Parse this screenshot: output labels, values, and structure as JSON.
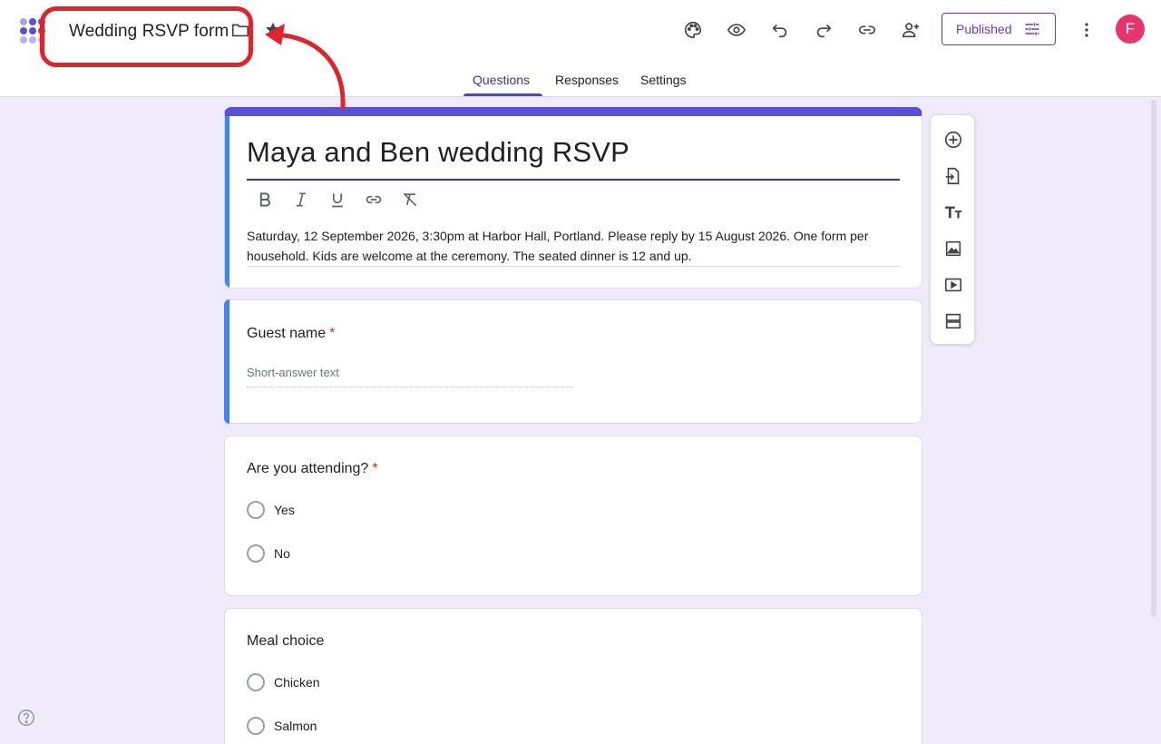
{
  "app": {
    "title": "Wedding RSVP form",
    "accent_color": "#673ab7",
    "theme_color": "#5b4fd9"
  },
  "header": {
    "icons": [
      "folder-icon",
      "star-icon",
      "palette-icon",
      "preview-icon",
      "undo-icon",
      "redo-icon",
      "link-icon",
      "add-collaborator-icon",
      "more-icon"
    ],
    "publish_label": "Published",
    "avatar_initial": "F"
  },
  "tabs": [
    {
      "label": "Questions",
      "active": true
    },
    {
      "label": "Responses",
      "active": false
    },
    {
      "label": "Settings",
      "active": false
    }
  ],
  "form": {
    "title": "Maya and Ben wedding RSVP",
    "description": "Saturday, 12 September 2026, 3:30pm at Harbor Hall, Portland. Please reply by 15 August 2026. One form per household. Kids are welcome at the ceremony. The seated dinner is 12 and up.",
    "format_tools": [
      "bold-icon",
      "italic-icon",
      "underline-icon",
      "link-icon",
      "clear-format-icon"
    ]
  },
  "questions": [
    {
      "title": "Guest name",
      "required": true,
      "type": "short",
      "placeholder": "Short-answer text"
    },
    {
      "title": "Are you attending?",
      "required": true,
      "type": "radio",
      "options": [
        "Yes",
        "No"
      ]
    },
    {
      "title": "Meal choice",
      "required": false,
      "type": "radio",
      "options": [
        "Chicken",
        "Salmon"
      ]
    }
  ],
  "side_toolbar": [
    "add-question-icon",
    "import-questions-icon",
    "add-title-icon",
    "add-image-icon",
    "add-video-icon",
    "add-section-icon"
  ],
  "required_mark": "*"
}
